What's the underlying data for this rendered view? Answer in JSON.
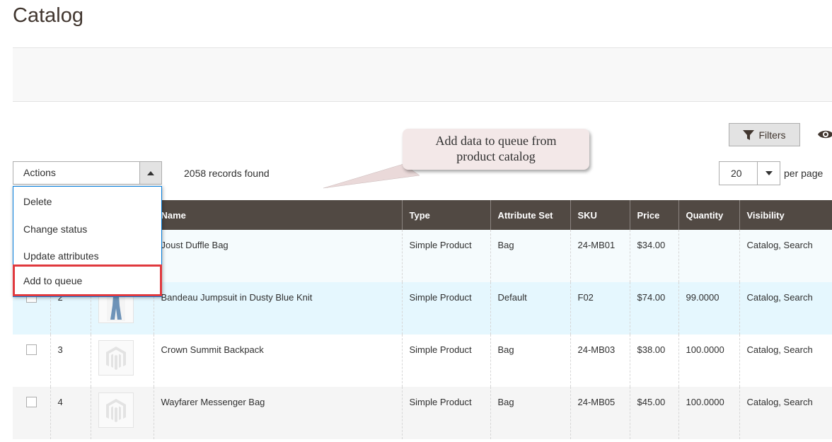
{
  "page": {
    "title": "Catalog"
  },
  "toolbar": {
    "filters_label": "Filters",
    "actions_label": "Actions",
    "records_found": "2058 records found",
    "per_page_value": "20",
    "per_page_label": "per page"
  },
  "actions_menu": {
    "items": [
      {
        "label": "Delete"
      },
      {
        "label": "Change status"
      },
      {
        "label": "Update attributes"
      },
      {
        "label": "Add to queue"
      }
    ]
  },
  "callout": {
    "line1": "Add data to queue from",
    "line2": "product catalog"
  },
  "grid": {
    "columns": [
      "",
      "",
      "",
      "Name",
      "Type",
      "Attribute Set",
      "SKU",
      "Price",
      "Quantity",
      "Visibility"
    ],
    "rows": [
      {
        "id": "",
        "name": "Joust Duffle Bag",
        "type": "Simple Product",
        "attribute_set": "Bag",
        "sku": "24-MB01",
        "price": "$34.00",
        "quantity": "",
        "visibility": "Catalog, Search"
      },
      {
        "id": "2",
        "name": "Bandeau Jumpsuit in Dusty Blue Knit",
        "type": "Simple Product",
        "attribute_set": "Default",
        "sku": "F02",
        "price": "$74.00",
        "quantity": "99.0000",
        "visibility": "Catalog, Search"
      },
      {
        "id": "3",
        "name": "Crown Summit Backpack",
        "type": "Simple Product",
        "attribute_set": "Bag",
        "sku": "24-MB03",
        "price": "$38.00",
        "quantity": "100.0000",
        "visibility": "Catalog, Search"
      },
      {
        "id": "4",
        "name": "Wayfarer Messenger Bag",
        "type": "Simple Product",
        "attribute_set": "Bag",
        "sku": "24-MB05",
        "price": "$45.00",
        "quantity": "100.0000",
        "visibility": "Catalog, Search"
      }
    ]
  },
  "colors": {
    "header_bg": "#514943",
    "highlight_row": "#e5f7fe",
    "menu_border": "#007bdb",
    "callout_box_border": "#e0393e"
  }
}
